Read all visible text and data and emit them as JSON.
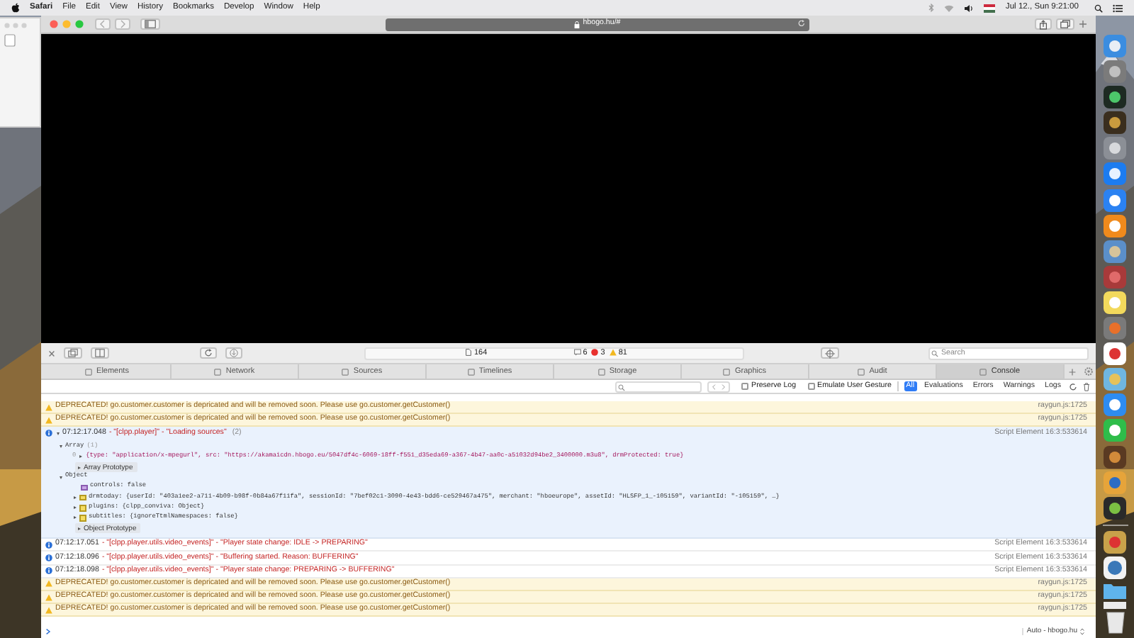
{
  "menu_bar": {
    "app": "Safari",
    "menus": [
      "File",
      "Edit",
      "View",
      "History",
      "Bookmarks",
      "Develop",
      "Window",
      "Help"
    ],
    "clock": "Jul 12., Sun 9:21:00"
  },
  "browser": {
    "address": "hbogo.hu/#"
  },
  "inspector": {
    "resource_count": "164",
    "log_count": "6",
    "error_count": "3",
    "warning_count": "81",
    "search_placeholder": "Search",
    "tabs": [
      {
        "label": "Elements",
        "selected": false
      },
      {
        "label": "Network",
        "selected": false
      },
      {
        "label": "Sources",
        "selected": false
      },
      {
        "label": "Timelines",
        "selected": false
      },
      {
        "label": "Storage",
        "selected": false
      },
      {
        "label": "Graphics",
        "selected": false
      },
      {
        "label": "Audit",
        "selected": false
      },
      {
        "label": "Console",
        "selected": true
      }
    ],
    "options": [
      {
        "label": "Preserve Log",
        "checked": false
      },
      {
        "label": "Emulate User Gesture",
        "checked": false
      }
    ],
    "levels": [
      {
        "label": "All",
        "selected": true
      },
      {
        "label": "Evaluations",
        "selected": false
      },
      {
        "label": "Errors",
        "selected": false
      },
      {
        "label": "Warnings",
        "selected": false
      },
      {
        "label": "Logs",
        "selected": false
      }
    ],
    "messages": [
      {
        "kind": "warning",
        "text": "DEPRECATED! go.customer.customer is depricated and will be removed soon. Please use go.customer.getCustomer()",
        "source": "raygun.js:1725"
      },
      {
        "kind": "warning",
        "text": "DEPRECATED! go.customer.customer is depricated and will be removed soon. Please use go.customer.getCustomer()",
        "source": "raygun.js:1725"
      },
      {
        "kind": "info",
        "expanded": true,
        "time": "07:12:17.048",
        "text": "- \"[clpp.player]\" - \"Loading sources\"",
        "count": "(2)",
        "source": "Script Element 16:3:533614",
        "children": [
          {
            "kind": "group",
            "text": "Array",
            "count": "(1)",
            "expanded": true,
            "children": [
              {
                "kind": "entry",
                "index": "0",
                "expanded": false,
                "text": "{type: \"application/x-mpegurl\", src: \"https://akamaicdn.hbogo.eu/5047df4c-6069-18ff-f551_d35eda69-a367-4b47-aa0c-a51032d94be2_3400000.m3u8\", drmProtected: true}"
              },
              {
                "kind": "prototype",
                "expanded": false,
                "text": "Array Prototype"
              }
            ]
          },
          {
            "kind": "group",
            "text": "Object",
            "expanded": true,
            "children": [
              {
                "kind": "boolean",
                "text": "controls: false"
              },
              {
                "kind": "property",
                "expanded": false,
                "text": "drmtoday: {userId: \"403a1ee2-a711-4b09-b98f-0b84a67f11fa\", sessionId: \"7bef02c1-3090-4e43-bdd6-ce529467a475\", merchant: \"hboeurope\", assetId: \"HLSFP_1_-105159\", variantId: \"-105159\", …}"
              },
              {
                "kind": "property",
                "expanded": false,
                "text": "plugins: {clpp_conviva: Object}"
              },
              {
                "kind": "property",
                "expanded": false,
                "text": "subtitles: {ignoreTtmlNamespaces: false}"
              },
              {
                "kind": "prototype",
                "expanded": false,
                "text": "Object Prototype"
              }
            ]
          }
        ]
      },
      {
        "kind": "info",
        "time": "07:12:17.051",
        "text": "- \"[clpp.player.utils.video_events]\" - \"Player state change: IDLE -> PREPARING\"",
        "source": "Script Element 16:3:533614"
      },
      {
        "kind": "info",
        "time": "07:12:18.096",
        "text": "- \"[clpp.player.utils.video_events]\" - \"Buffering started. Reason: BUFFERING\"",
        "source": "Script Element 16:3:533614"
      },
      {
        "kind": "info",
        "time": "07:12:18.098",
        "text": "- \"[clpp.player.utils.video_events]\" - \"Player state change: PREPARING -> BUFFERING\"",
        "source": "Script Element 16:3:533614"
      },
      {
        "kind": "warning",
        "text": "DEPRECATED! go.customer.customer is depricated and will be removed soon. Please use go.customer.getCustomer()",
        "source": "raygun.js:1725"
      },
      {
        "kind": "warning",
        "text": "DEPRECATED! go.customer.customer is depricated and will be removed soon. Please use go.customer.getCustomer()",
        "source": "raygun.js:1725"
      },
      {
        "kind": "warning",
        "text": "DEPRECATED! go.customer.customer is depricated and will be removed soon. Please use go.customer.getCustomer()",
        "source": "raygun.js:1725"
      }
    ],
    "context": "Auto - hbogo.hu"
  }
}
